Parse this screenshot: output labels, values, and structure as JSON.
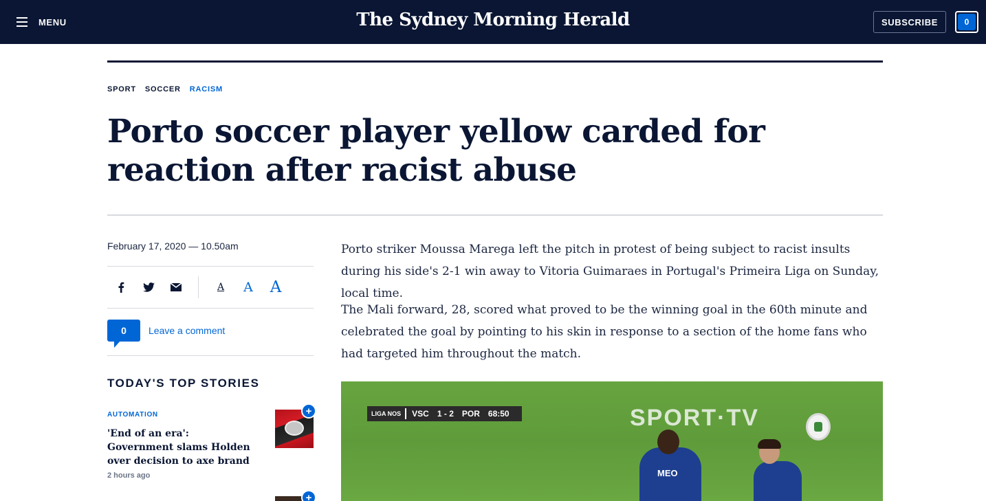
{
  "header": {
    "menu_label": "MENU",
    "masthead": "The Sydney Morning Herald",
    "subscribe_label": "SUBSCRIBE",
    "count": "0"
  },
  "breadcrumb": [
    "SPORT",
    "SOCCER",
    "RACISM"
  ],
  "article": {
    "headline": "Porto soccer player yellow carded for reaction after racist abuse",
    "dateline": "February 17, 2020 — 10.50am",
    "paragraphs": [
      "Porto striker Moussa Marega left the pitch in protest of being subject to racist insults during his side's 2-1 win away to Vitoria Guimaraes in Portugal's Primeira Liga on Sunday, local time.",
      "The Mali forward, 28, scored what proved to be the winning goal in the 60th minute and celebrated the goal by pointing to his skin in response to a section of the home fans who had targeted him throughout the match."
    ]
  },
  "share": {
    "icons": [
      "facebook-icon",
      "twitter-icon",
      "email-icon"
    ],
    "font_size_glyph": "A"
  },
  "comments": {
    "count": "0",
    "link_label": "Leave a comment"
  },
  "sidebar": {
    "heading": "TODAY'S TOP STORIES",
    "stories": [
      {
        "tag": "AUTOMATION",
        "title": "'End of an era': Government slams Holden over decision to axe brand",
        "time": "2 hours ago"
      }
    ],
    "plus_glyph": "+"
  },
  "video": {
    "scorebug": {
      "league": "LIGA NOS",
      "home": "VSC",
      "score": "1 - 2",
      "away": "POR",
      "clock": "68:50"
    },
    "broadcaster": "SPORT·TV",
    "shirt_sponsor": "MEO"
  },
  "colors": {
    "navy": "#0a1633",
    "accent_blue": "#0066d6",
    "rule_grey": "#d7d9de"
  }
}
